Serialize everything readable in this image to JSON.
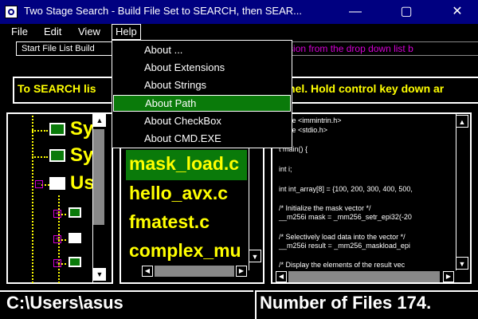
{
  "window": {
    "title": "Two Stage Search - Build File Set to SEARCH, then SEAR...",
    "minimize_glyph": "—",
    "maximize_glyph": "▢",
    "close_glyph": "✕"
  },
  "menubar": {
    "file": "File",
    "edit": "Edit",
    "view": "View",
    "help": "Help"
  },
  "help_menu": {
    "items": [
      "About ...",
      "About Extensions",
      "About Strings",
      "About Path",
      "About CheckBox",
      "About CMD.EXE"
    ],
    "selected": "About Path"
  },
  "toolbar": {
    "start_button": "Start File List Build",
    "hint": "ct extension from the drop down list b"
  },
  "instruction": {
    "left": "To SEARCH lis",
    "right": "nel. Hold control key down ar"
  },
  "tree": {
    "items": [
      "Sy",
      "Sy",
      "Us"
    ],
    "expand_glyph": "+",
    "collapse_glyph": "−"
  },
  "files": {
    "items": [
      "mask_load.c",
      "hello_avx.c",
      "fmatest.c",
      "complex_mu"
    ],
    "selected": "mask_load.c"
  },
  "code": {
    "lines": [
      "clude <immintrin.h>",
      "clude <stdio.h>",
      "",
      "t main() {",
      "",
      "int i;",
      "",
      "int int_array[8] = {100, 200, 300, 400, 500,",
      "",
      "/* Initialize the mask vector */",
      "__m256i mask = _mm256_setr_epi32(-20",
      "",
      "/* Selectively load data into the vector */",
      "__m256i result = _mm256_maskload_epi",
      "",
      "/* Display the elements of the result vec"
    ]
  },
  "status": {
    "path": "C:\\Users\\asus",
    "count": "Number of Files 174."
  },
  "icons": {
    "scroll_up": "▲",
    "scroll_down": "▼",
    "scroll_left": "◀",
    "scroll_right": "▶"
  },
  "colors": {
    "title_bar": "#000080",
    "highlight_green": "#0a7a0a",
    "text_yellow": "#ffff00",
    "hint_magenta": "#d400d4"
  }
}
